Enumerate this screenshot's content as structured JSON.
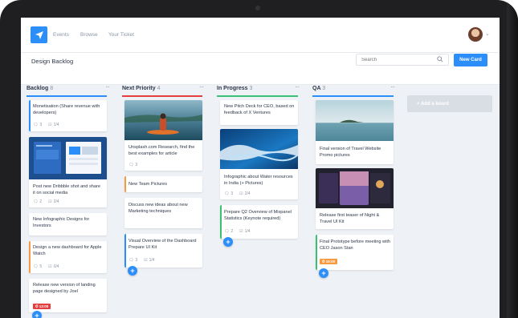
{
  "nav": {
    "links": [
      "Events",
      "Browse",
      "Your Ticket"
    ]
  },
  "header": {
    "title": "Design Backlog",
    "search_placeholder": "Search",
    "new_card_label": "New Card"
  },
  "colors": {
    "accent": "#2c8ef8",
    "red": "#e53e3e",
    "green": "#38c172",
    "orange": "#f6993f"
  },
  "columns": [
    {
      "name": "Backlog",
      "count": "8",
      "cards": [
        {
          "title": "Monetisation (Share revenue with developers)",
          "comments": "3",
          "tasks": "1/4"
        },
        {
          "title": "Post new Dribbble shot and share it on social media",
          "comments": "2",
          "tasks": "2/4"
        },
        {
          "title": "New Infographic Designs for Investors"
        },
        {
          "title": "Design a new dashboard for Apple Watch",
          "comments": "5",
          "tasks": "0/4"
        },
        {
          "title": "Release new version of landing page designed by Joel",
          "badge": "13:00"
        }
      ]
    },
    {
      "name": "Next Priority",
      "count": "4",
      "cards": [
        {
          "title": "Unsplash.com Research, find the best examples for article",
          "comments": "3"
        },
        {
          "title": "New Team Pictures"
        },
        {
          "title": "Discuss new ideas about new Marketing techniques"
        },
        {
          "title": "Visual Overview of the Dashboard Prepare UI Kit",
          "comments": "3",
          "tasks": "1/4"
        }
      ]
    },
    {
      "name": "In Progress",
      "count": "3",
      "cards": [
        {
          "title": "New Pitch Deck for CEO, based on feedback of X Ventures"
        },
        {
          "title": "Infographic about Water resources in India (+ Pictures)",
          "comments": "3",
          "tasks": "2/4"
        },
        {
          "title": "Prepare Q2 Overview of Mixpanel Statistics (Keynote required)",
          "comments": "2",
          "tasks": "1/4"
        }
      ]
    },
    {
      "name": "QA",
      "count": "3",
      "cards": [
        {
          "title": "Final version of Travel Website Promo pictures"
        },
        {
          "title": "Release first teaser of Night & Travel UI Kit"
        },
        {
          "title": "Final Prototype before meeting with CEO Jason Stan",
          "badge": "16:00"
        }
      ]
    }
  ],
  "add_board_label": "+ Add a board"
}
